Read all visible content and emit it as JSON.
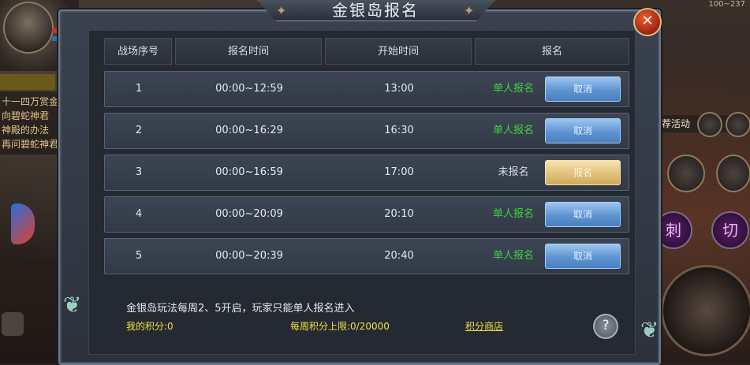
{
  "window": {
    "title": "金银岛报名",
    "close_symbol": "✕"
  },
  "table": {
    "headers": [
      "战场序号",
      "报名时间",
      "开始时间",
      "报名"
    ],
    "rows": [
      {
        "index": "1",
        "signup_time": "00:00~12:59",
        "start_time": "13:00",
        "status": "单人报名",
        "status_color": "green",
        "action": "取消"
      },
      {
        "index": "2",
        "signup_time": "00:00~16:29",
        "start_time": "16:30",
        "status": "单人报名",
        "status_color": "green",
        "action": "取消"
      },
      {
        "index": "3",
        "signup_time": "00:00~16:59",
        "start_time": "17:00",
        "status": "未报名",
        "status_color": "gray",
        "action": "报名"
      },
      {
        "index": "4",
        "signup_time": "00:00~20:09",
        "start_time": "20:10",
        "status": "单人报名",
        "status_color": "green",
        "action": "取消"
      },
      {
        "index": "5",
        "signup_time": "00:00~20:39",
        "start_time": "20:40",
        "status": "单人报名",
        "status_color": "green",
        "action": "取消"
      }
    ]
  },
  "footer": {
    "rules": "金银岛玩法每周2、5开启，玩家只能单人报名进入",
    "my_score": "我的积分:0",
    "weekly_limit": "每周积分上限:0/20000",
    "shop_link": "积分商店",
    "help_symbol": "?"
  },
  "game_hud": {
    "quest_lines": [
      "十一四万赏金",
      "向碧蛇神君",
      "神殿的办法",
      "再问碧蛇神君"
    ],
    "recommend": "荐活动",
    "skill_1": "刺",
    "skill_2": "切",
    "top_right": "100~237"
  },
  "colors": {
    "status_green": "#3ed23e",
    "button_blue": "#5e94d2",
    "button_gold": "#e2c27a",
    "footer_yellow": "#f0e040"
  }
}
